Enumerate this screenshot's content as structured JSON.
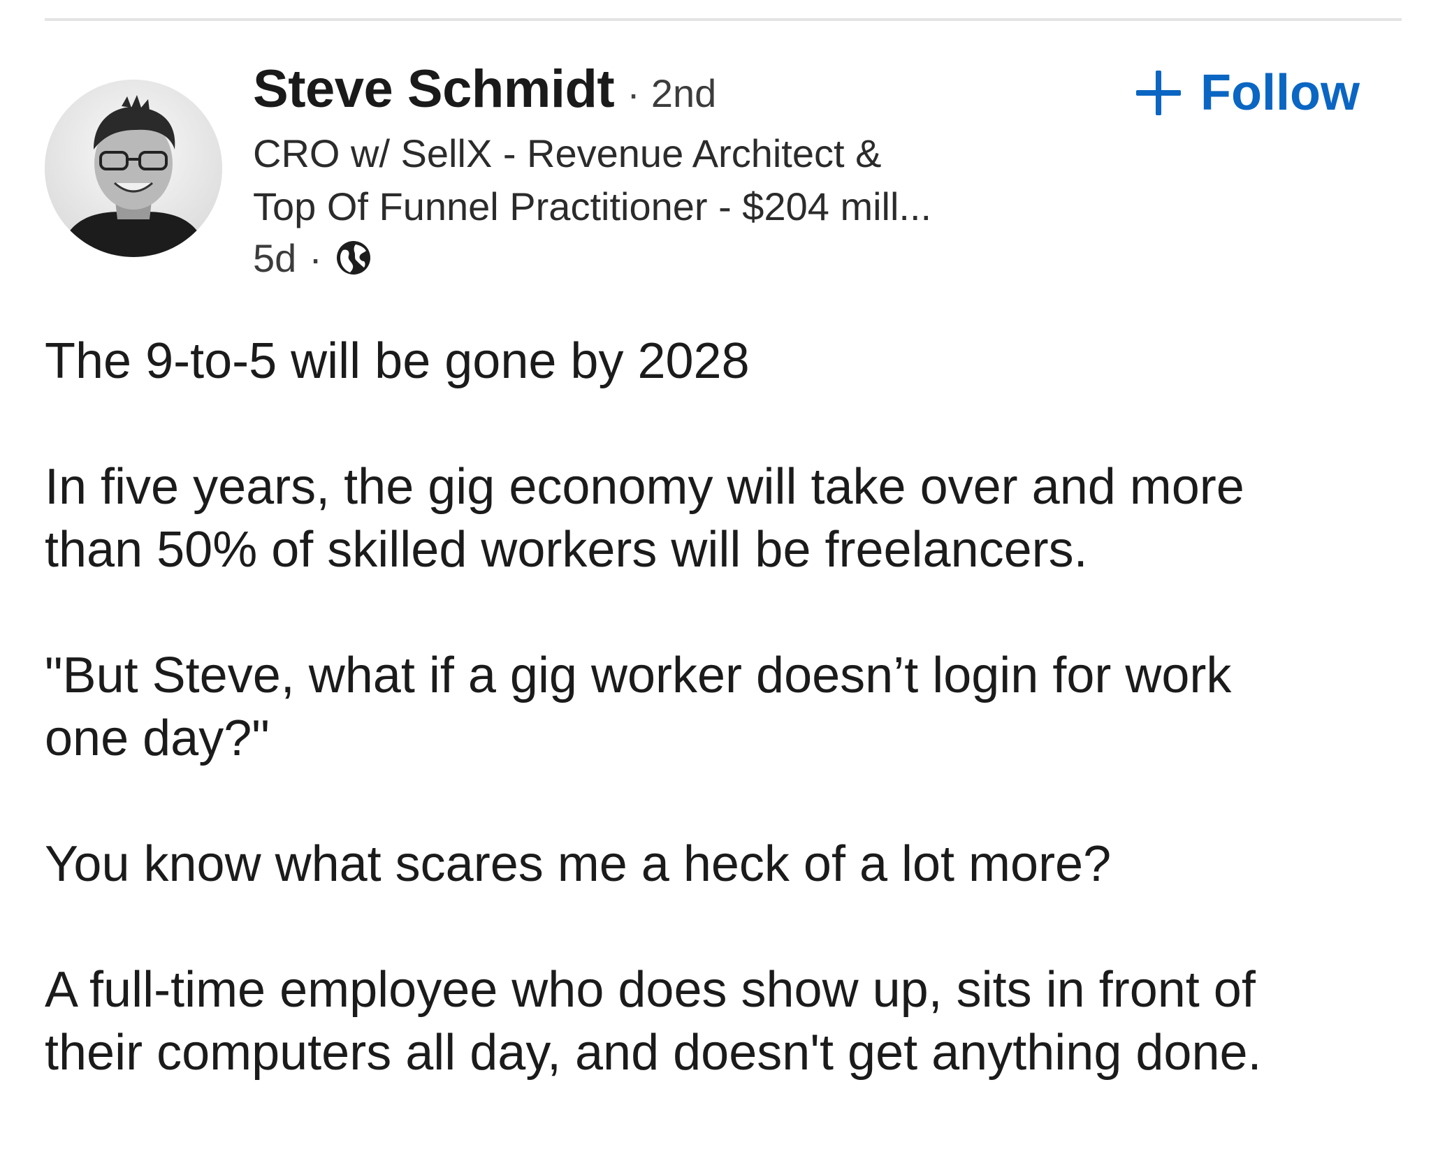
{
  "post": {
    "author": {
      "name": "Steve Schmidt",
      "separator": "·",
      "connection_degree": "2nd",
      "headline_lines": [
        "CRO w/ SellX - Revenue Architect &",
        "Top Of Funnel Practitioner - $204 mill..."
      ],
      "avatar_icon": "profile-photo"
    },
    "meta": {
      "age": "5d",
      "separator": "·",
      "visibility_icon": "globe-icon"
    },
    "follow_button": {
      "label": "Follow",
      "icon": "plus-icon",
      "color": "#0a66c2"
    },
    "body": {
      "paragraph_1": "The 9-to-5 will be gone by 2028",
      "paragraph_2": [
        "In five years, the gig economy will take over and more",
        "than 50% of skilled workers will be freelancers."
      ],
      "paragraph_3": [
        "\"But Steve, what if a gig worker doesn’t login for work",
        "one day?\""
      ],
      "paragraph_4": "You know what scares me a heck of a lot more?",
      "paragraph_5": [
        "A full-time employee who does show up, sits in front of",
        "their computers all day, and doesn't get anything done."
      ]
    }
  }
}
